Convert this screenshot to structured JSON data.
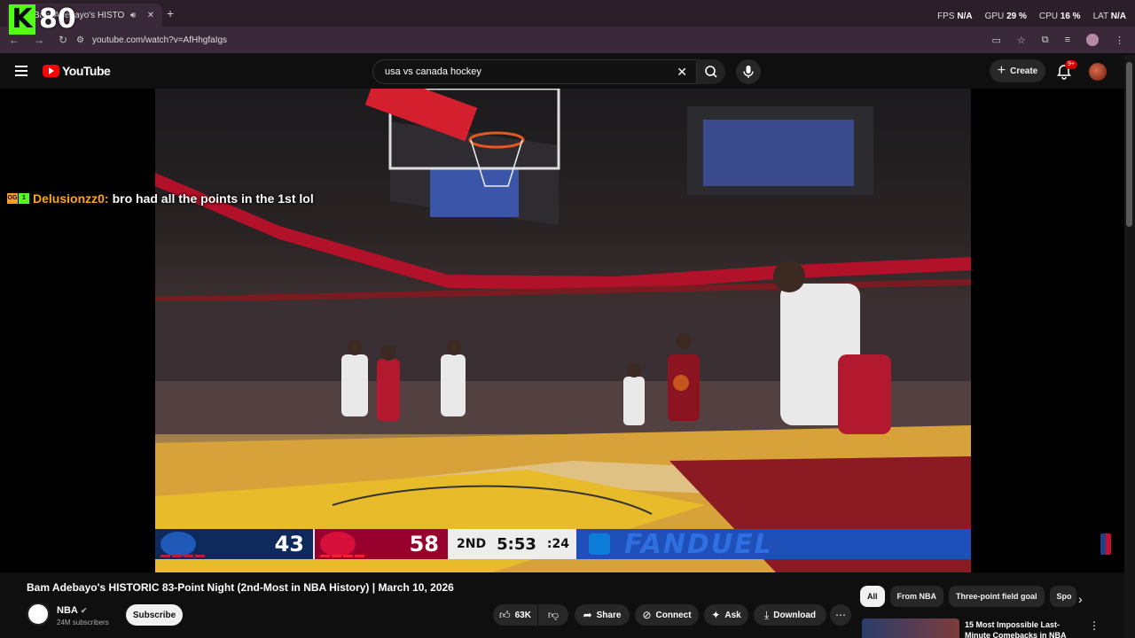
{
  "browser": {
    "tab_title": "Bam Adebayo's HISTO",
    "url": "youtube.com/watch?v=AfHhgfaIgs",
    "perf": [
      {
        "label": "FPS",
        "value": "N/A"
      },
      {
        "label": "GPU",
        "value": "29 %"
      },
      {
        "label": "CPU",
        "value": "16 %"
      },
      {
        "label": "LAT",
        "value": "N/A"
      }
    ]
  },
  "overlay": {
    "kick_logo": "K",
    "kick_count": "80",
    "chat_badges": [
      "OG",
      "1"
    ],
    "chat_user": "Delusionzz0:",
    "chat_message": "bro had all the points in the 1st lol"
  },
  "youtube": {
    "logo_text": "YouTube",
    "search_value": "usa vs canada hockey",
    "create_label": "Create",
    "notifications_badge": "9+"
  },
  "scorebug": {
    "away_score": "43",
    "home_score": "58",
    "quarter": "2ND",
    "clock": "5:53",
    "shot_clock": ":24",
    "sponsor": "FANDUEL"
  },
  "video": {
    "title": "Bam Adebayo's HISTORIC 83-Point Night (2nd-Most in NBA History) | March 10, 2026",
    "channel_name": "NBA",
    "subscribers": "24M subscribers",
    "subscribe_label": "Subscribe",
    "likes": "63K",
    "share_label": "Share",
    "connect_label": "Connect",
    "ask_label": "Ask",
    "download_label": "Download"
  },
  "chips": [
    "All",
    "From NBA",
    "Three-point field goal",
    "Spo"
  ],
  "recommendation": {
    "title": "15 Most Impossible Last-Minute Comebacks in NBA"
  }
}
